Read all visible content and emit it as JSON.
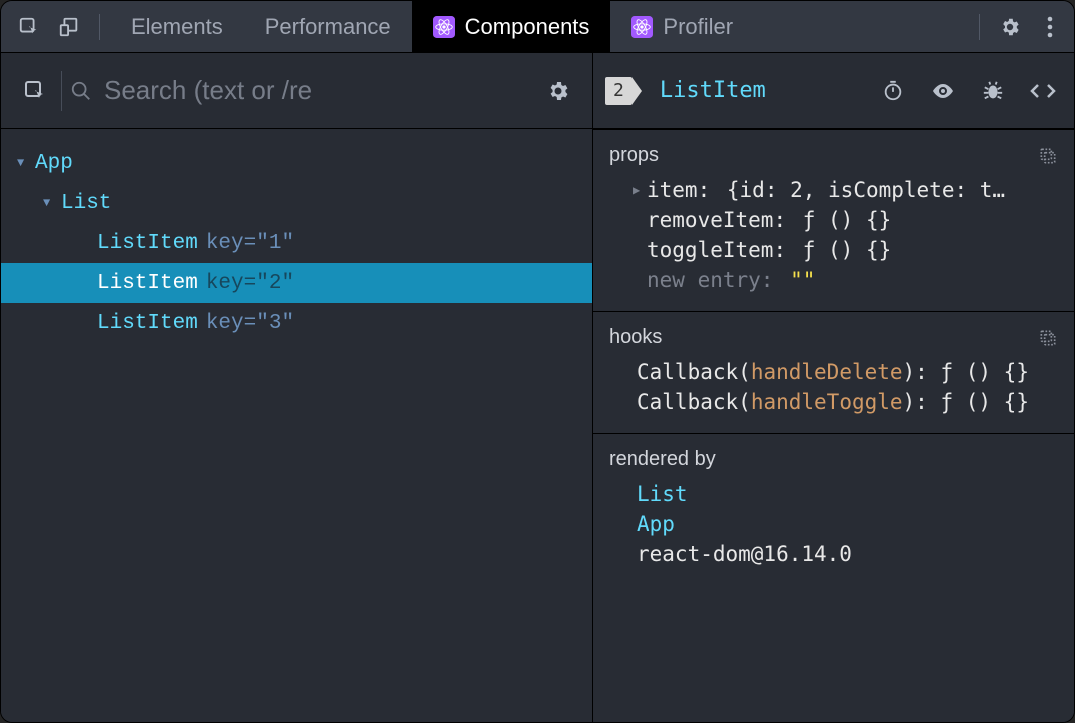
{
  "tabs": {
    "elements": "Elements",
    "performance": "Performance",
    "components": "Components",
    "profiler": "Profiler"
  },
  "search": {
    "placeholder": "Search (text or /re"
  },
  "tree": {
    "root": "App",
    "list": "List",
    "items": [
      {
        "name": "ListItem",
        "keyLabel": "key=",
        "keyValue": "\"1\""
      },
      {
        "name": "ListItem",
        "keyLabel": "key=",
        "keyValue": "\"2\""
      },
      {
        "name": "ListItem",
        "keyLabel": "key=",
        "keyValue": "\"3\""
      }
    ]
  },
  "selected": {
    "renderCount": "2",
    "name": "ListItem"
  },
  "props": {
    "title": "props",
    "item": {
      "label": "item",
      "value": "{id: 2, isComplete: t…"
    },
    "removeItem": {
      "label": "removeItem",
      "value": "ƒ () {}"
    },
    "toggleItem": {
      "label": "toggleItem",
      "value": "ƒ () {}"
    },
    "newEntry": {
      "label": "new entry",
      "value": "\"\""
    }
  },
  "hooks": {
    "title": "hooks",
    "rows": [
      {
        "prefix": "Callback",
        "name": "handleDelete",
        "suffix": "ƒ () {}"
      },
      {
        "prefix": "Callback",
        "name": "handleToggle",
        "suffix": "ƒ () {}"
      }
    ]
  },
  "renderedBy": {
    "title": "rendered by",
    "items": [
      "List",
      "App"
    ],
    "renderer": "react-dom@16.14.0"
  }
}
